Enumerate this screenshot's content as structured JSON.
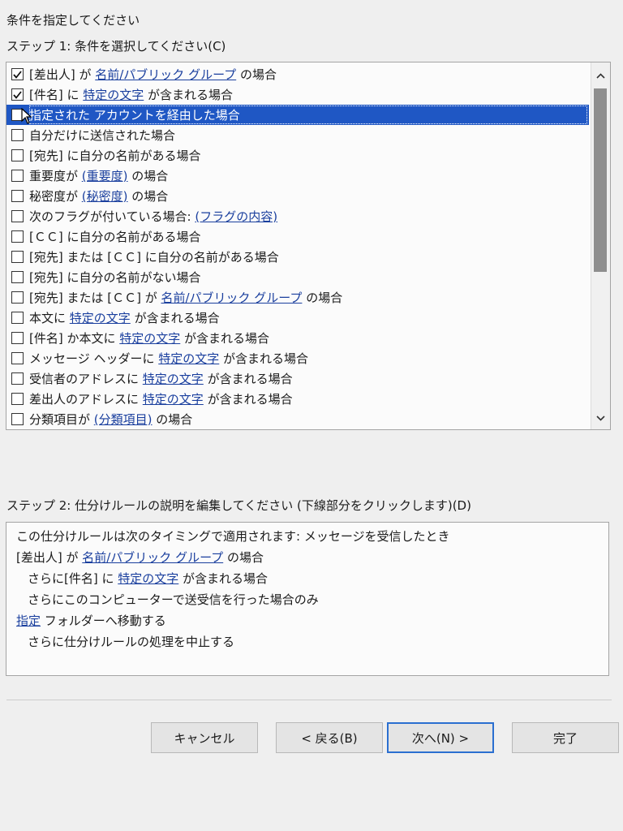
{
  "dialog": {
    "title": "条件を指定してください",
    "step1_label": "ステップ 1: 条件を選択してください(C)",
    "step2_label": "ステップ 2: 仕分けルールの説明を編集してください (下線部分をクリックします)(D)"
  },
  "conditions": [
    {
      "checked": true,
      "selected": false,
      "parts": [
        {
          "t": "[差出人] が "
        },
        {
          "t": "名前/パブリック グループ",
          "link": true
        },
        {
          "t": " の場合"
        }
      ]
    },
    {
      "checked": true,
      "selected": false,
      "parts": [
        {
          "t": "[件名] に "
        },
        {
          "t": "特定の文字",
          "link": true
        },
        {
          "t": " が含まれる場合"
        }
      ]
    },
    {
      "checked": false,
      "selected": true,
      "parts": [
        {
          "t": "指定された アカウントを経由した場合"
        }
      ]
    },
    {
      "checked": false,
      "selected": false,
      "parts": [
        {
          "t": "自分だけに送信された場合"
        }
      ]
    },
    {
      "checked": false,
      "selected": false,
      "parts": [
        {
          "t": "[宛先] に自分の名前がある場合"
        }
      ]
    },
    {
      "checked": false,
      "selected": false,
      "parts": [
        {
          "t": "重要度が "
        },
        {
          "t": "(重要度)",
          "link": true
        },
        {
          "t": " の場合"
        }
      ]
    },
    {
      "checked": false,
      "selected": false,
      "parts": [
        {
          "t": "秘密度が "
        },
        {
          "t": "(秘密度)",
          "link": true
        },
        {
          "t": " の場合"
        }
      ]
    },
    {
      "checked": false,
      "selected": false,
      "parts": [
        {
          "t": "次のフラグが付いている場合: "
        },
        {
          "t": "(フラグの内容)",
          "link": true
        }
      ]
    },
    {
      "checked": false,
      "selected": false,
      "parts": [
        {
          "t": "[ＣＣ] に自分の名前がある場合"
        }
      ]
    },
    {
      "checked": false,
      "selected": false,
      "parts": [
        {
          "t": "[宛先] または [ＣＣ] に自分の名前がある場合"
        }
      ]
    },
    {
      "checked": false,
      "selected": false,
      "parts": [
        {
          "t": "[宛先] に自分の名前がない場合"
        }
      ]
    },
    {
      "checked": false,
      "selected": false,
      "parts": [
        {
          "t": "[宛先] または [ＣＣ] が "
        },
        {
          "t": "名前/パブリック グループ",
          "link": true
        },
        {
          "t": " の場合"
        }
      ]
    },
    {
      "checked": false,
      "selected": false,
      "parts": [
        {
          "t": "本文に "
        },
        {
          "t": "特定の文字",
          "link": true
        },
        {
          "t": " が含まれる場合"
        }
      ]
    },
    {
      "checked": false,
      "selected": false,
      "parts": [
        {
          "t": "[件名] か本文に "
        },
        {
          "t": "特定の文字",
          "link": true
        },
        {
          "t": " が含まれる場合"
        }
      ]
    },
    {
      "checked": false,
      "selected": false,
      "parts": [
        {
          "t": "メッセージ ヘッダーに "
        },
        {
          "t": "特定の文字",
          "link": true
        },
        {
          "t": " が含まれる場合"
        }
      ]
    },
    {
      "checked": false,
      "selected": false,
      "parts": [
        {
          "t": "受信者のアドレスに "
        },
        {
          "t": "特定の文字",
          "link": true
        },
        {
          "t": " が含まれる場合"
        }
      ]
    },
    {
      "checked": false,
      "selected": false,
      "parts": [
        {
          "t": "差出人のアドレスに "
        },
        {
          "t": "特定の文字",
          "link": true
        },
        {
          "t": " が含まれる場合"
        }
      ]
    },
    {
      "checked": false,
      "selected": false,
      "parts": [
        {
          "t": "分類項目が "
        },
        {
          "t": "(分類項目)",
          "link": true
        },
        {
          "t": " の場合"
        }
      ]
    }
  ],
  "description": [
    {
      "indent": false,
      "parts": [
        {
          "t": "この仕分けルールは次のタイミングで適用されます: メッセージを受信したとき"
        }
      ]
    },
    {
      "indent": false,
      "parts": [
        {
          "t": "[差出人] が "
        },
        {
          "t": "名前/パブリック グループ",
          "link": true
        },
        {
          "t": " の場合"
        }
      ]
    },
    {
      "indent": true,
      "parts": [
        {
          "t": "さらに[件名] に "
        },
        {
          "t": "特定の文字",
          "link": true
        },
        {
          "t": " が含まれる場合"
        }
      ]
    },
    {
      "indent": true,
      "parts": [
        {
          "t": "さらにこのコンピューターで送受信を行った場合のみ"
        }
      ]
    },
    {
      "indent": false,
      "parts": [
        {
          "t": "指定",
          "link": true
        },
        {
          "t": " フォルダーへ移動する"
        }
      ]
    },
    {
      "indent": true,
      "parts": [
        {
          "t": "さらに仕分けルールの処理を中止する"
        }
      ]
    }
  ],
  "buttons": {
    "cancel": "キャンセル",
    "back": "< 戻る(B)",
    "next": "次へ(N) >",
    "finish": "完了"
  },
  "icons": {
    "check": "☑",
    "scroll_up": "^",
    "scroll_down": "v",
    "cursor": "pointer-arrow"
  }
}
